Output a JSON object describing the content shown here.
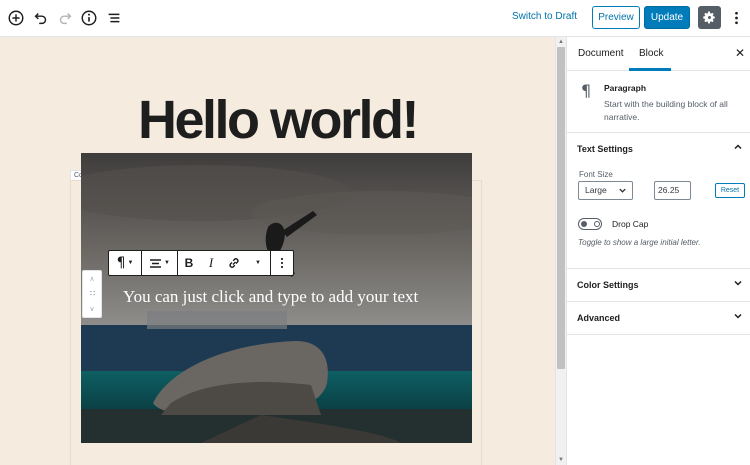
{
  "topbar": {
    "switch_to_draft": "Switch to Draft",
    "preview_label": "Preview",
    "update_label": "Update",
    "icons": [
      "add-block-icon",
      "undo-icon",
      "redo-icon",
      "info-icon",
      "list-view-icon",
      "gear-icon",
      "more-vertical-icon"
    ],
    "accent_color": "#007cba"
  },
  "editor": {
    "post_title": "Hello world!",
    "cover_label": "Cover",
    "cover_text": "You can just click and type to add your text",
    "background_color": "#f5ecdf"
  },
  "sidebar": {
    "tabs": [
      {
        "label": "Document"
      },
      {
        "label": "Block",
        "active": true
      }
    ],
    "block_card": {
      "title": "Paragraph",
      "description": "Start with the building block of all narrative."
    },
    "text_settings": {
      "title": "Text Settings",
      "font_size_label": "Font Size",
      "font_size_value": "Large",
      "font_size_number": "26.25",
      "reset_label": "Reset",
      "drop_cap_label": "Drop Cap",
      "drop_cap_help": "Toggle to show a large initial letter."
    },
    "color_settings_title": "Color Settings",
    "advanced_title": "Advanced"
  }
}
